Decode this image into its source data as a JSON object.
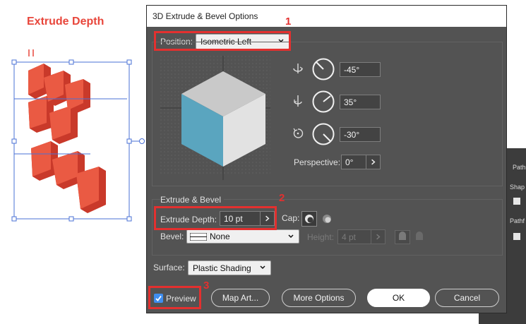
{
  "artwork": {
    "title": "Extrude Depth",
    "title_color": "#e8463b"
  },
  "side_panel": {
    "labels": [
      "Path",
      "Shap",
      "Pathf"
    ]
  },
  "dialog": {
    "title": "3D Extrude & Bevel Options",
    "position_label": "Position:",
    "position_value": "Isometric Left",
    "rotation": {
      "x_value": "-45°",
      "y_value": "35°",
      "z_value": "-30°"
    },
    "perspective_label": "Perspective:",
    "perspective_value": "0°",
    "extrude_section_label": "Extrude & Bevel",
    "extrude_depth_label": "Extrude Depth:",
    "extrude_depth_value": "10 pt",
    "cap_label": "Cap:",
    "bevel_label": "Bevel:",
    "bevel_value": "None",
    "height_label": "Height:",
    "height_value": "4 pt",
    "surface_label": "Surface:",
    "surface_value": "Plastic Shading",
    "preview_label": "Preview",
    "preview_checked": true,
    "buttons": {
      "map_art": "Map Art...",
      "more_options": "More Options",
      "ok": "OK",
      "cancel": "Cancel"
    }
  },
  "annotations": {
    "color": "#e3302f",
    "numbers": [
      "1",
      "2",
      "3"
    ]
  },
  "colors": {
    "dialog_bg": "#535353",
    "cube_top": "#c9c9c9",
    "cube_left": "#5aa5bf",
    "cube_right": "#e2e2e2",
    "extrude_red": "#d4412e"
  }
}
